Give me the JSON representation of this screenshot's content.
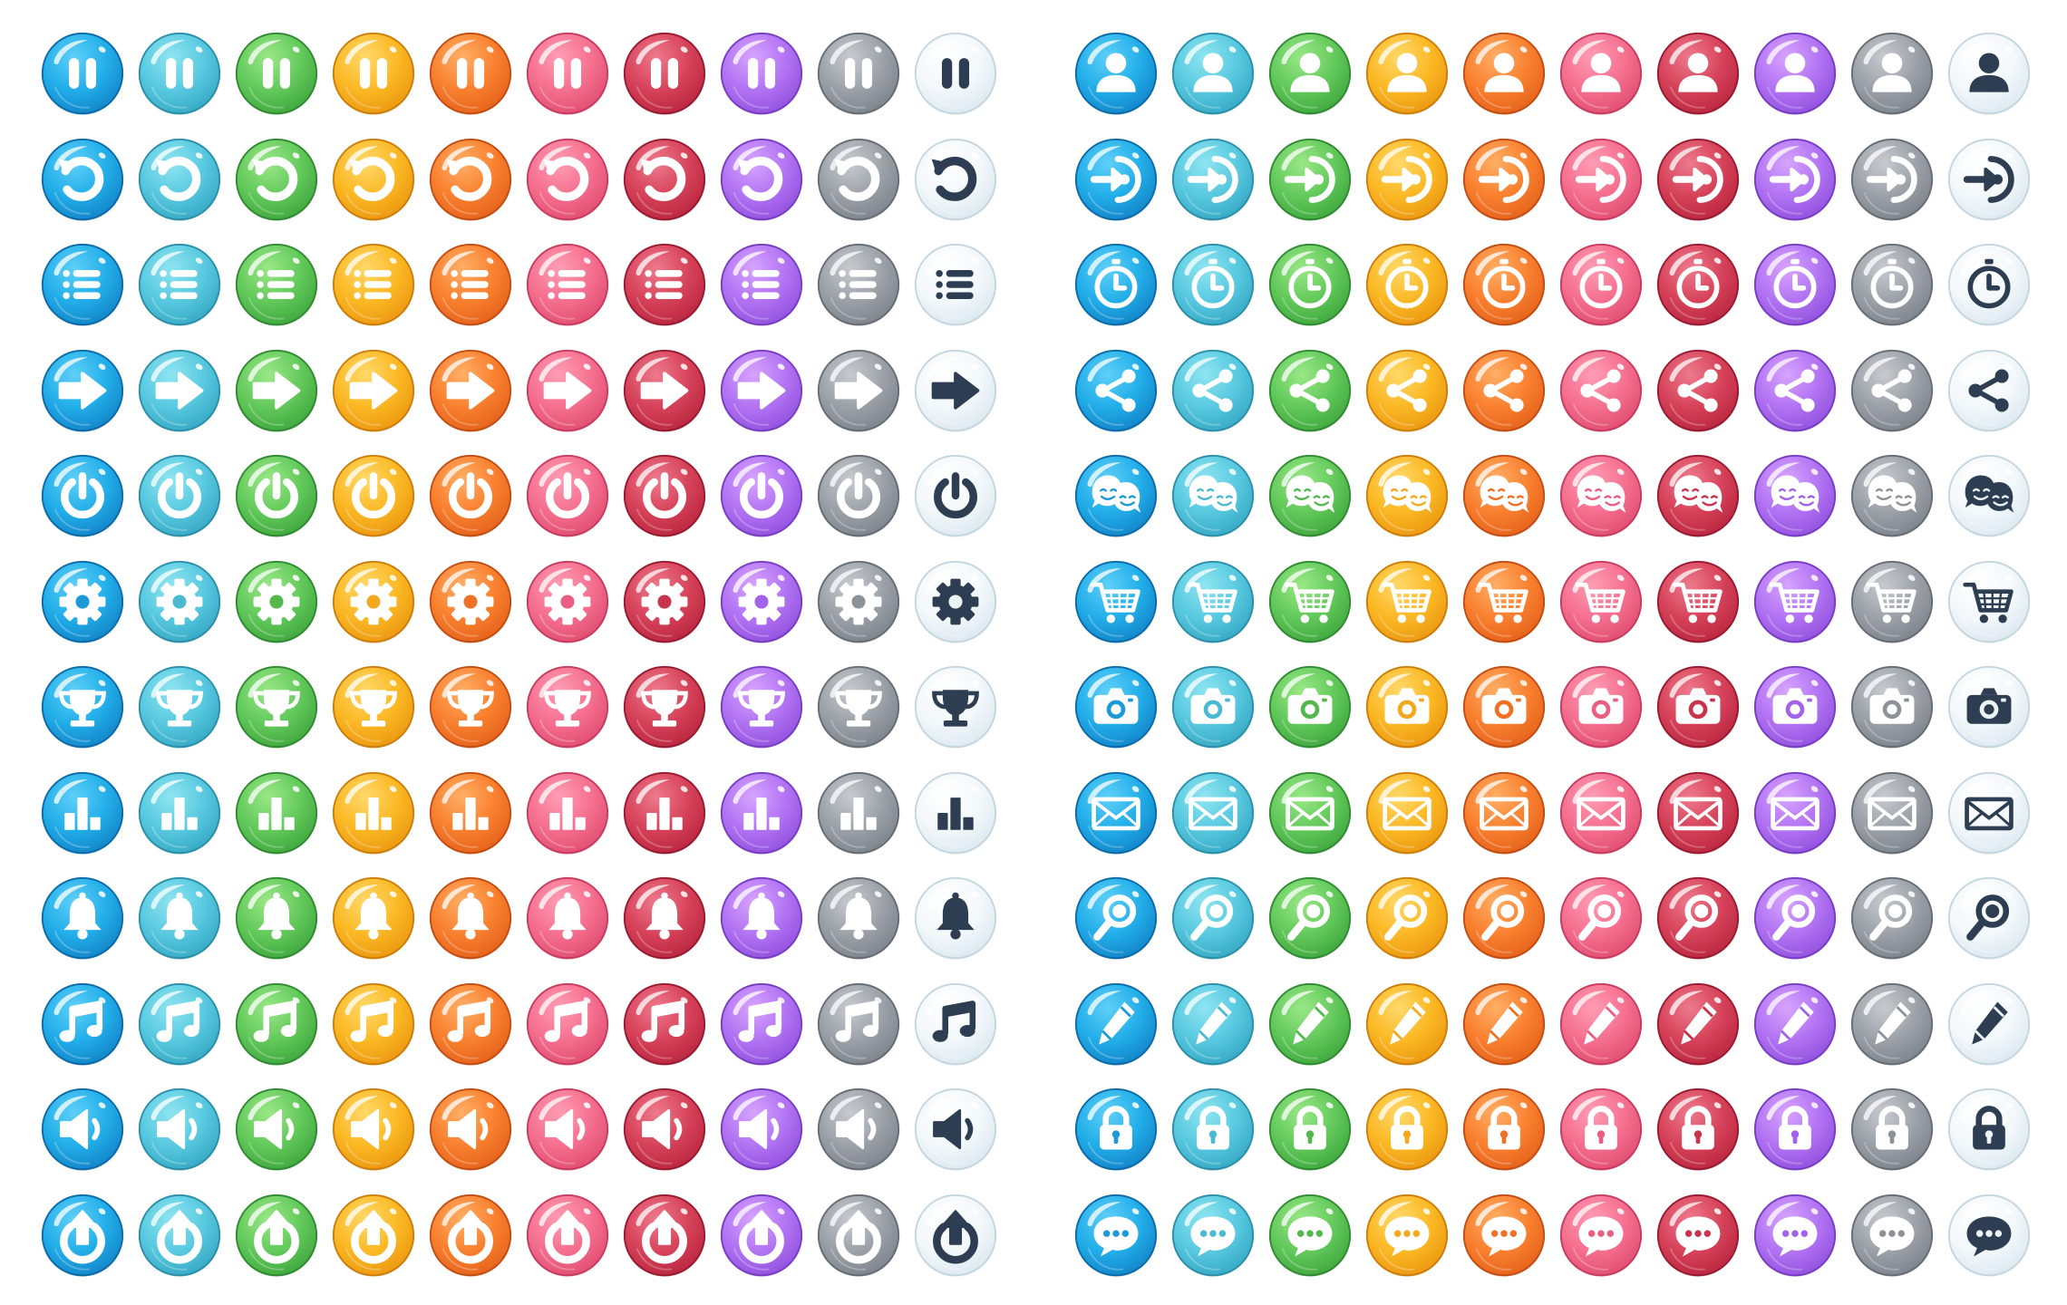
{
  "palettes": [
    {
      "name": "blue",
      "light": "#5fd0f8",
      "mid": "#22aee9",
      "dark": "#1284c8",
      "rim": "#0c6aa9",
      "glyph": "#ffffff",
      "hole": "#1c9ad8"
    },
    {
      "name": "cyan",
      "light": "#8fe5f1",
      "mid": "#58c9e0",
      "dark": "#36a8c4",
      "rim": "#2b8fa9",
      "glyph": "#ffffff",
      "hole": "#4cb9d3"
    },
    {
      "name": "green",
      "light": "#9ae887",
      "mid": "#63c95b",
      "dark": "#3fa73e",
      "rim": "#2f8a31",
      "glyph": "#ffffff",
      "hole": "#54b84f"
    },
    {
      "name": "yellow",
      "light": "#ffd96a",
      "mid": "#fbb824",
      "dark": "#eb9710",
      "rim": "#cc7d0a",
      "glyph": "#ffffff",
      "hole": "#f2a91d"
    },
    {
      "name": "orange",
      "light": "#ffaf66",
      "mid": "#f9802f",
      "dark": "#e4621b",
      "rim": "#c24d12",
      "glyph": "#ffffff",
      "hole": "#ee7126"
    },
    {
      "name": "pink",
      "light": "#ff9db4",
      "mid": "#f56f8f",
      "dark": "#e04d71",
      "rim": "#c63b5e",
      "glyph": "#ffffff",
      "hole": "#ea5f81"
    },
    {
      "name": "crimson",
      "light": "#ee7a8d",
      "mid": "#d64259",
      "dark": "#b9263f",
      "rim": "#981a31",
      "glyph": "#ffffff",
      "hole": "#c8344c"
    },
    {
      "name": "purple",
      "light": "#d7a4ff",
      "mid": "#b273f3",
      "dark": "#9151de",
      "rim": "#773cc2",
      "glyph": "#ffffff",
      "hole": "#a262e9"
    },
    {
      "name": "gray",
      "light": "#c7cbd0",
      "mid": "#9ca1a8",
      "dark": "#7d838b",
      "rim": "#666c74",
      "glyph": "#ffffff",
      "hole": "#8d9299"
    },
    {
      "name": "white",
      "light": "#ffffff",
      "mid": "#f3f8fb",
      "dark": "#dbe8ef",
      "rim": "#c3d6e0",
      "glyph": "#2e3e52",
      "hole": "#edf4f8"
    }
  ],
  "panels": [
    {
      "side": "left",
      "rows": [
        {
          "name": "pause",
          "icon": "pause-icon"
        },
        {
          "name": "restart",
          "icon": "restart-icon"
        },
        {
          "name": "menu",
          "icon": "list-menu-icon"
        },
        {
          "name": "next",
          "icon": "arrow-right-icon"
        },
        {
          "name": "power",
          "icon": "power-icon"
        },
        {
          "name": "settings",
          "icon": "gear-icon"
        },
        {
          "name": "trophy",
          "icon": "trophy-icon"
        },
        {
          "name": "leaderboard",
          "icon": "bar-chart-icon"
        },
        {
          "name": "notification",
          "icon": "bell-icon"
        },
        {
          "name": "music",
          "icon": "music-note-icon"
        },
        {
          "name": "sound",
          "icon": "speaker-icon"
        },
        {
          "name": "upload",
          "icon": "upload-icon"
        }
      ]
    },
    {
      "side": "right",
      "rows": [
        {
          "name": "profile",
          "icon": "user-icon"
        },
        {
          "name": "login",
          "icon": "login-icon"
        },
        {
          "name": "timer",
          "icon": "stopwatch-icon"
        },
        {
          "name": "share",
          "icon": "share-icon"
        },
        {
          "name": "friends",
          "icon": "friends-icon"
        },
        {
          "name": "shop",
          "icon": "shopping-cart-icon"
        },
        {
          "name": "camera",
          "icon": "camera-icon"
        },
        {
          "name": "mail",
          "icon": "envelope-icon"
        },
        {
          "name": "search",
          "icon": "magnifier-icon"
        },
        {
          "name": "edit",
          "icon": "pencil-icon"
        },
        {
          "name": "lock",
          "icon": "padlock-icon"
        },
        {
          "name": "chat",
          "icon": "chat-bubble-icon"
        }
      ]
    }
  ]
}
